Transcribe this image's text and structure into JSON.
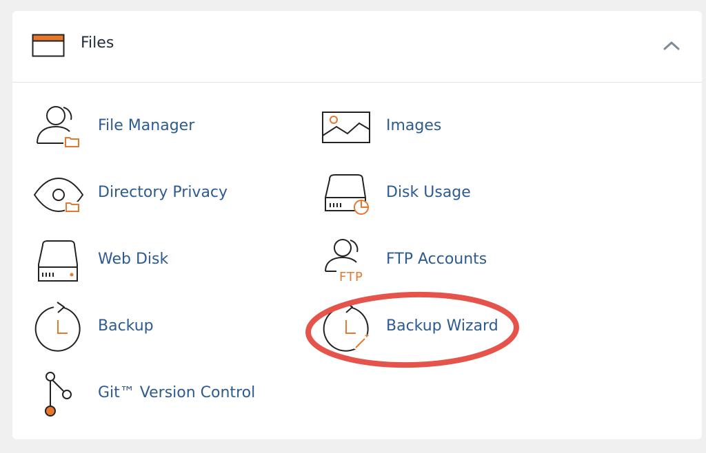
{
  "section": {
    "title": "Files",
    "header_icon": "folder-icon",
    "collapse_icon": "chevron-up-icon"
  },
  "tools": [
    {
      "label": "File Manager",
      "icon": "user-folder-icon"
    },
    {
      "label": "Images",
      "icon": "image-icon"
    },
    {
      "label": "Directory Privacy",
      "icon": "eye-folder-icon"
    },
    {
      "label": "Disk Usage",
      "icon": "disk-pie-icon"
    },
    {
      "label": "Web Disk",
      "icon": "drive-icon"
    },
    {
      "label": "FTP Accounts",
      "icon": "user-ftp-icon",
      "icon_text": "FTP"
    },
    {
      "label": "Backup",
      "icon": "backup-clock-icon"
    },
    {
      "label": "Backup Wizard",
      "icon": "backup-wand-icon"
    },
    {
      "label": "Git™ Version Control",
      "icon": "git-branch-icon"
    }
  ],
  "annotation": {
    "highlighted_item": "Backup Wizard",
    "color": "#e5534b"
  },
  "colors": {
    "accent_orange": "#e8772e",
    "link_blue": "#2d5b8f",
    "icon_stroke": "#222222",
    "page_bg": "#f0f0f0",
    "panel_bg": "#ffffff"
  }
}
